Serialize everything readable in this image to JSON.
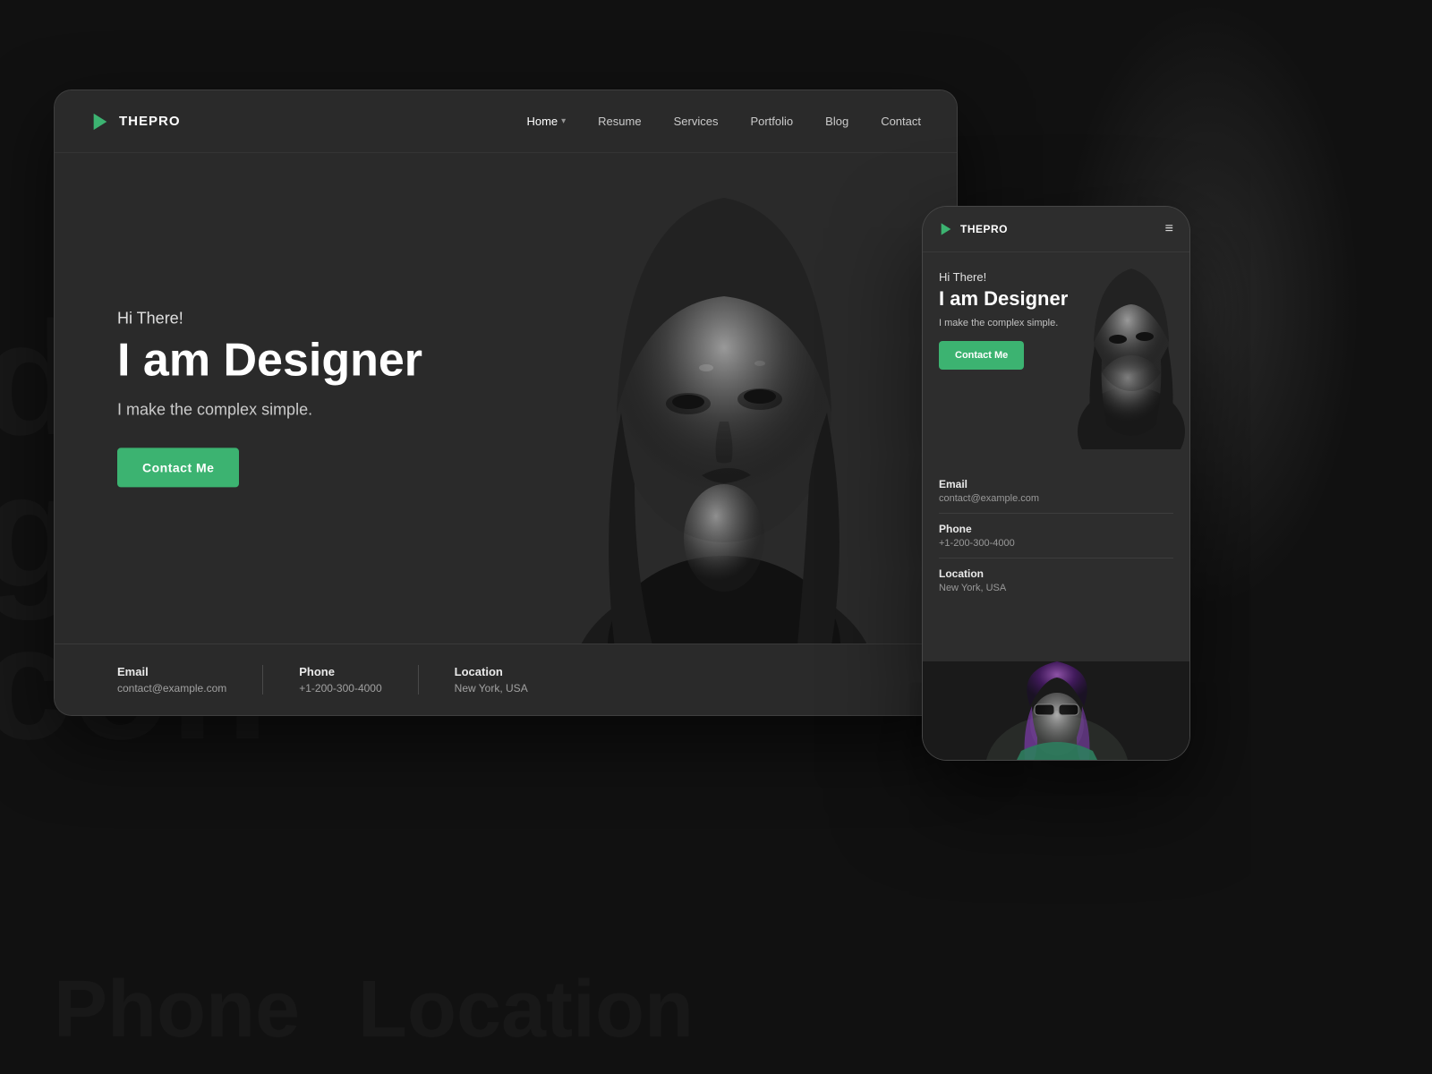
{
  "background": {
    "large_text_1": "desi",
    "large_text_2": "gner",
    "large_text_contact": "con",
    "bottom_text_1": "Phone",
    "bottom_text_2": "Location"
  },
  "desktop": {
    "logo": {
      "icon": "▶",
      "text": "THEPRO"
    },
    "nav": {
      "items": [
        {
          "label": "Home",
          "active": true,
          "has_dropdown": true
        },
        {
          "label": "Resume",
          "active": false,
          "has_dropdown": false
        },
        {
          "label": "Services",
          "active": false,
          "has_dropdown": false
        },
        {
          "label": "Portfolio",
          "active": false,
          "has_dropdown": false
        },
        {
          "label": "Blog",
          "active": false,
          "has_dropdown": false
        },
        {
          "label": "Contact",
          "active": false,
          "has_dropdown": false
        }
      ]
    },
    "hero": {
      "greeting": "Hi There!",
      "headline": "I am Designer",
      "subline": "I make the complex simple.",
      "cta_label": "Contact Me"
    },
    "footer_info": {
      "email_label": "Email",
      "email_value": "contact@example.com",
      "phone_label": "Phone",
      "phone_value": "+1-200-300-4000",
      "location_label": "Location",
      "location_value": "New York, USA"
    }
  },
  "mobile": {
    "logo": {
      "icon": "▶",
      "text": "THEPRO"
    },
    "hamburger": "≡",
    "hero": {
      "greeting": "Hi There!",
      "headline": "I am Designer",
      "subline": "I make the complex simple.",
      "cta_label": "Contact Me"
    },
    "contact_info": {
      "email_label": "Email",
      "email_value": "contact@example.com",
      "phone_label": "Phone",
      "phone_value": "+1-200-300-4000",
      "location_label": "Location",
      "location_value": "New York, USA"
    }
  },
  "colors": {
    "accent": "#3cb371",
    "bg_dark": "#1a1a1a",
    "card_bg": "#2a2a2a",
    "text_primary": "#ffffff",
    "text_secondary": "rgba(255,255,255,0.55)"
  }
}
